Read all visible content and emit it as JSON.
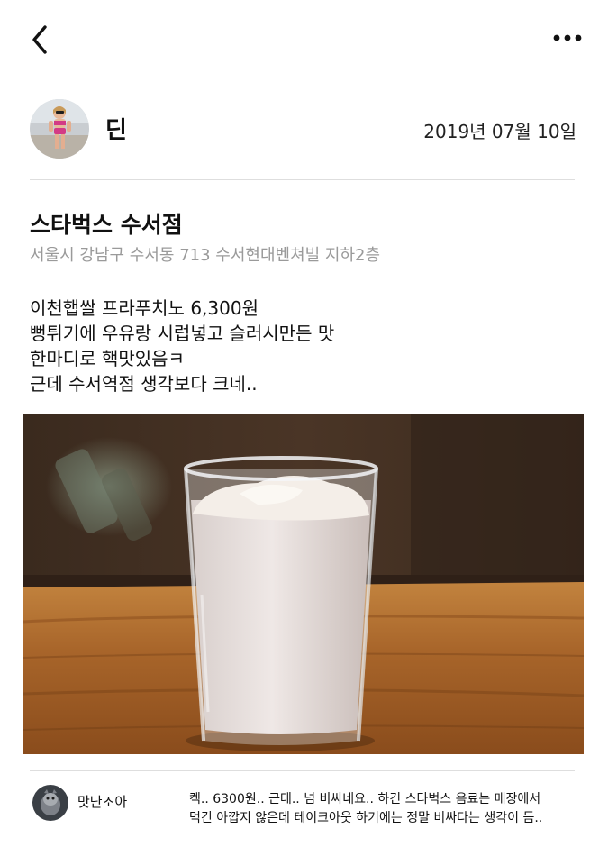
{
  "nav": {
    "back": "chevron-left-icon",
    "more": "more-horizontal-icon"
  },
  "author": {
    "name": "딘",
    "date": "2019년 07월 10일"
  },
  "place": {
    "name": "스타벅스 수서점",
    "address": "서울시 강남구 수서동 713 수서현대벤쳐빌 지하2층"
  },
  "post": {
    "lines": [
      "이천햅쌀 프라푸치노 6,300원",
      "뻥튀기에 우유랑 시럽넣고 슬러시만든 맛",
      "한마디로 핵맛있음ㅋ",
      "근데 수서역점 생각보다 크네.."
    ]
  },
  "comment": {
    "author": "맛난조아",
    "lines": [
      "켁.. 6300원.. 근데.. 넘 비싸네요.. 하긴 스타벅스 음료는 매장에서",
      "먹긴 아깝지 않은데 테이크아웃 하기에는 정말 비싸다는 생각이 듬.."
    ]
  },
  "colors": {
    "divider": "#dedede",
    "address": "#9a9a9a",
    "wood": "#a6612a"
  }
}
